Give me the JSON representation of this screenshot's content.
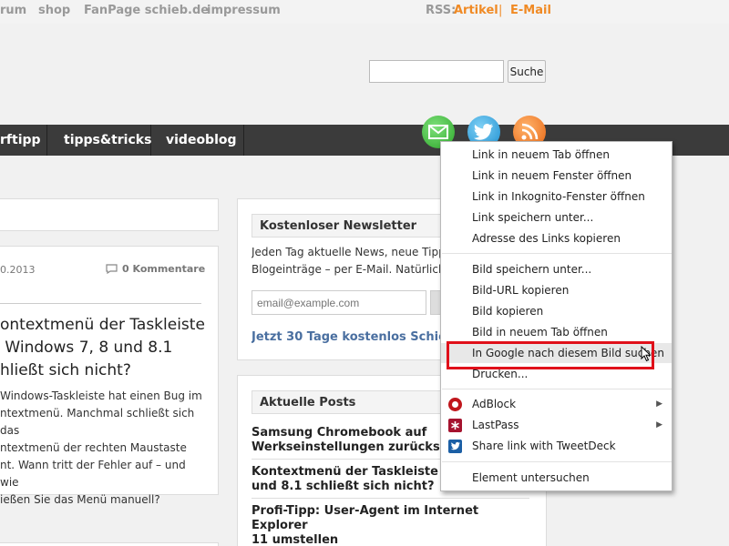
{
  "topnav": {
    "links": [
      "rum",
      "shop",
      "FanPage schieb.de",
      "impressum"
    ],
    "rss_label": "RSS:",
    "rss_links": [
      "Artikel",
      "E-Mail"
    ],
    "separator": "|"
  },
  "search": {
    "value": "",
    "button_label": "Suche"
  },
  "mainnav": {
    "items": [
      "rftipp",
      "tipps&tricks",
      "videoblog"
    ]
  },
  "social_icons": [
    "mail-icon",
    "twitter-icon",
    "rss-icon"
  ],
  "article": {
    "date": "0.2013",
    "comments": "0 Kommentare",
    "title": "ontextmenü der Taskleiste Windows 7, 8 und 8.1 hließt sich nicht?",
    "title_lines": [
      "ontextmenü der Taskleiste",
      " Windows 7, 8 und 8.1",
      "hließt sich nicht?"
    ],
    "text_lines": [
      "Windows-Taskleiste hat einen Bug im",
      "ntextmenü. Manchmal schließt sich das",
      "ntextmenü der rechten Maustaste",
      "nt. Wann tritt der Fehler auf – und wie",
      "ießen Sie das Menü manuell?"
    ]
  },
  "newsletter": {
    "heading": "Kostenloser Newsletter",
    "text_lines": [
      "Jeden Tag aktuelle News, neue Tipp",
      "Blogeinträge – per E-Mail. Natürlich"
    ],
    "email_placeholder": "email@example.com",
    "cta": "Jetzt 30 Tage kostenlos Schieb"
  },
  "posts": {
    "heading": "Aktuelle Posts",
    "items": [
      [
        "Samsung Chromebook auf",
        "Werkseinstellungen zurücksetz"
      ],
      [
        "Kontextmenü der Taskleiste in",
        "und 8.1 schließt sich nicht?"
      ],
      [
        "Profi-Tipp: User-Agent im Internet Explorer",
        "11 umstellen"
      ]
    ]
  },
  "context_menu": {
    "groups": [
      [
        "Link in neuem Tab öffnen",
        "Link in neuem Fenster öffnen",
        "Link in Inkognito-Fenster öffnen",
        "Link speichern unter...",
        "Adresse des Links kopieren"
      ],
      [
        "Bild speichern unter...",
        "Bild-URL kopieren",
        "Bild kopieren",
        "Bild in neuem Tab öffnen",
        "In Google nach diesem Bild suchen",
        "Drucken..."
      ],
      [
        "AdBlock",
        "LastPass",
        "Share link with TweetDeck"
      ],
      [
        "Element untersuchen"
      ]
    ],
    "highlighted_item": "In Google nach diesem Bild suchen",
    "extension_icons": [
      "adblock-icon",
      "lastpass-icon",
      "tweetdeck-icon"
    ]
  },
  "colors": {
    "accent": "#f08a24",
    "navbar": "#3b3b3b",
    "highlight_box": "#e0101a",
    "link_blue": "#4a6fa0"
  }
}
